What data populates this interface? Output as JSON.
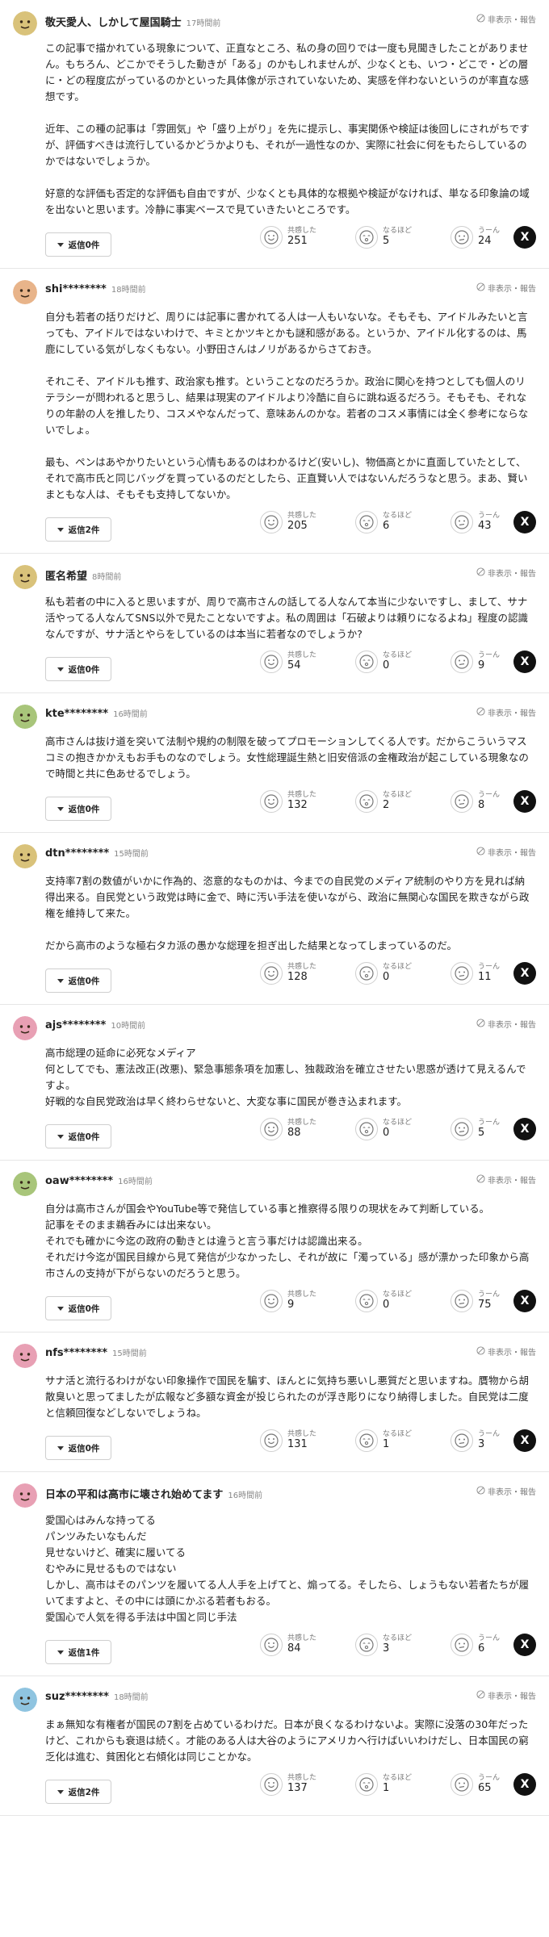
{
  "common": {
    "report_label": "非表示・報告",
    "empathy_label": "共感した",
    "insight_label": "なるほど",
    "hmm_label": "うーん",
    "x_label": "X"
  },
  "comments": [
    {
      "user": "敬天愛人、しかして屋国騎士",
      "time": "17時間前",
      "avatar_color": "#d9c27a",
      "paragraphs": [
        "この記事で描かれている現象について、正直なところ、私の身の回りでは一度も見聞きしたことがありません。もちろん、どこかでそうした動きが「ある」のかもしれませんが、少なくとも、いつ・どこで・どの層に・どの程度広がっているのかといった具体像が示されていないため、実感を伴わないというのが率直な感想です。",
        "近年、この種の記事は「雰囲気」や「盛り上がり」を先に提示し、事実関係や検証は後回しにされがちですが、評価すべきは流行しているかどうかよりも、それが一過性なのか、実際に社会に何をもたらしているのかではないでしょうか。",
        "好意的な評価も否定的な評価も自由ですが、少なくとも具体的な根拠や検証がなければ、単なる印象論の域を出ないと思います。冷静に事実ベースで見ていきたいところです。"
      ],
      "reply_label": "返信0件",
      "empathy": "251",
      "insight": "5",
      "hmm": "24"
    },
    {
      "user": "shi********",
      "time": "18時間前",
      "avatar_color": "#e8b48a",
      "paragraphs": [
        "自分も若者の括りだけど、周りには記事に書かれてる人は一人もいないな。そもそも、アイドルみたいと言っても、アイドルではないわけで、キミとかツキとかも謎和感がある。というか、アイドル化するのは、馬鹿にしている気がしなくもない。小野田さんはノリがあるからさておき。",
        "それこそ、アイドルも推す、政治家も推す。ということなのだろうか。政治に関心を持つとしても個人のリテラシーが問われると思うし、結果は現実のアイドルより冷酷に自らに跳ね返るだろう。そもそも、それなりの年齢の人を推したり、コスメやなんだって、意味あんのかな。若者のコスメ事情には全く参考にならないでしょ。",
        "最も、ペンはあやかりたいという心情もあるのはわかるけど(安いし)、物価高とかに直面していたとして、それで高市氏と同じバッグを買っているのだとしたら、正直賢い人ではないんだろうなと思う。まあ、賢いまともな人は、そもそも支持してないか。"
      ],
      "reply_label": "返信2件",
      "empathy": "205",
      "insight": "6",
      "hmm": "43"
    },
    {
      "user": "匿名希望",
      "time": "8時間前",
      "avatar_color": "#d9c27a",
      "paragraphs": [
        "私も若者の中に入ると思いますが、周りで高市さんの話してる人なんて本当に少ないですし、まして、サナ活やってる人なんてSNS以外で見たことないですよ。私の周囲は「石破よりは頼りになるよね」程度の認識なんですが、サナ活とやらをしているのは本当に若者なのでしょうか?"
      ],
      "reply_label": "返信0件",
      "empathy": "54",
      "insight": "0",
      "hmm": "9"
    },
    {
      "user": "kte********",
      "time": "16時間前",
      "avatar_color": "#a8c57a",
      "paragraphs": [
        "高市さんは抜け道を突いて法制や規約の制限を破ってプロモーションしてくる人です。だからこういうマスコミの抱きかかえもお手ものなのでしょう。女性総理誕生熱と旧安倍派の金権政治が起こしている現象なので時間と共に色あせるでしょう。"
      ],
      "reply_label": "返信0件",
      "empathy": "132",
      "insight": "2",
      "hmm": "8"
    },
    {
      "user": "dtn********",
      "time": "15時間前",
      "avatar_color": "#d9c27a",
      "paragraphs": [
        "支持率7割の数値がいかに作為的、恣意的なものかは、今までの自民党のメディア統制のやり方を見れば納得出来る。自民党という政党は時に金で、時に汚い手法を使いながら、政治に無関心な国民を欺きながら政権を維持して来た。",
        "だから高市のような極右タカ派の愚かな総理を担ぎ出した結果となってしまっているのだ。"
      ],
      "reply_label": "返信0件",
      "empathy": "128",
      "insight": "0",
      "hmm": "11"
    },
    {
      "user": "ajs********",
      "time": "10時間前",
      "avatar_color": "#e8a0b4",
      "paragraphs": [
        "高市総理の延命に必死なメディア\n何としてでも、憲法改正(改悪)、緊急事態条項を加憲し、独裁政治を確立させたい思惑が透けて見えるんですよ。\n好戦的な自民党政治は早く終わらせないと、大変な事に国民が巻き込まれます。"
      ],
      "reply_label": "返信0件",
      "empathy": "88",
      "insight": "0",
      "hmm": "5"
    },
    {
      "user": "oaw********",
      "time": "16時間前",
      "avatar_color": "#a8c57a",
      "paragraphs": [
        "自分は高市さんが国会やYouTube等で発信している事と推察得る限りの現状をみて判断している。\n記事をそのまま鵜呑みには出来ない。\nそれでも確かに今迄の政府の動きとは違うと言う事だけは認識出来る。\nそれだけ今迄が国民目線から見て発信が少なかったし、それが故に「濁っている」感が漂かった印象から高市さんの支持が下がらないのだろうと思う。"
      ],
      "reply_label": "返信0件",
      "empathy": "9",
      "insight": "0",
      "hmm": "75"
    },
    {
      "user": "nfs********",
      "time": "15時間前",
      "avatar_color": "#e8a0b4",
      "paragraphs": [
        "サナ活と流行るわけがない印象操作で国民を騙す、ほんとに気持ち悪いし悪質だと思いますね。贋物から胡散臭いと思ってましたが広報など多額な資金が投じられたのが浮き彫りになり納得しました。自民党は二度と信頼回復などしないでしょうね。"
      ],
      "reply_label": "返信0件",
      "empathy": "131",
      "insight": "1",
      "hmm": "3"
    },
    {
      "user": "日本の平和は高市に壊され始めてます",
      "time": "16時間前",
      "avatar_color": "#e8a0b4",
      "paragraphs": [
        "愛国心はみんな持ってる\nパンツみたいなもんだ\n見せないけど、確実に履いてる\nむやみに見せるものではない\nしかし、高市はそのパンツを履いてる人人手を上げてと、煽ってる。そしたら、しょうもない若者たちが履いてますよと、その中には頭にかぶる若者もおる。\n愛国心で人気を得る手法は中国と同じ手法"
      ],
      "reply_label": "返信1件",
      "empathy": "84",
      "insight": "3",
      "hmm": "6"
    },
    {
      "user": "suz********",
      "time": "18時間前",
      "avatar_color": "#8fc4e0",
      "paragraphs": [
        "まぁ無知な有権者が国民の7割を占めているわけだ。日本が良くなるわけないよ。実際に没落の30年だったけど、これからも衰退は続く。才能のある人は大谷のようにアメリカへ行けばいいわけだし、日本国民の窮乏化は進む、貧困化と右傾化は同じことかな。"
      ],
      "reply_label": "返信2件",
      "empathy": "137",
      "insight": "1",
      "hmm": "65"
    }
  ]
}
